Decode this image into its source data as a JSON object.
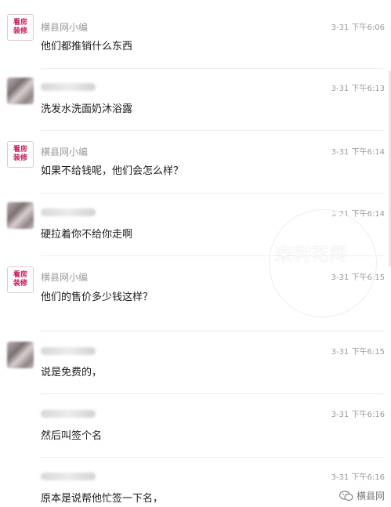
{
  "messages": [
    {
      "sender": "横县网小编",
      "avatar": "kanfang-zhuangxiu-logo",
      "time": "3-31 下午6:06",
      "text": "他们都推销什么东西"
    },
    {
      "sender": "",
      "avatar": "blurred-user-avatar",
      "time": "3-31 下午6:13",
      "text": "洗发水洗面奶沐浴露"
    },
    {
      "sender": "横县网小编",
      "avatar": "kanfang-zhuangxiu-logo",
      "time": "3-31 下午6:14",
      "text": "如果不给钱呢，他们会怎么样？"
    },
    {
      "sender": "",
      "avatar": "blurred-user-avatar",
      "time": "3-31 下午6:14",
      "text": "硬拉着你不给你走啊"
    },
    {
      "sender": "横县网小编",
      "avatar": "kanfang-zhuangxiu-logo",
      "time": "3-31 下午6:15",
      "text": "他们的售价多少钱这样？"
    },
    {
      "sender": "",
      "avatar": "blurred-user-avatar",
      "time": "3-31 下午6:15",
      "text": "说是免费的，"
    },
    {
      "sender": "",
      "avatar": "",
      "time": "3-31 下午6:16",
      "text": "然后叫签个名"
    },
    {
      "sender": "",
      "avatar": "",
      "time": "3-31 下午6:16",
      "text": "原本是说帮他忙签一下名，"
    }
  ],
  "logo_text": {
    "line1": "看房",
    "line2": "装修"
  },
  "watermark": {
    "text": "来利花网"
  },
  "footer": {
    "label": "横县网",
    "icon": "wechat-icon"
  },
  "colors": {
    "logo": "#c5185c",
    "meta": "#9a9a9a",
    "text": "#1a1a1a"
  }
}
